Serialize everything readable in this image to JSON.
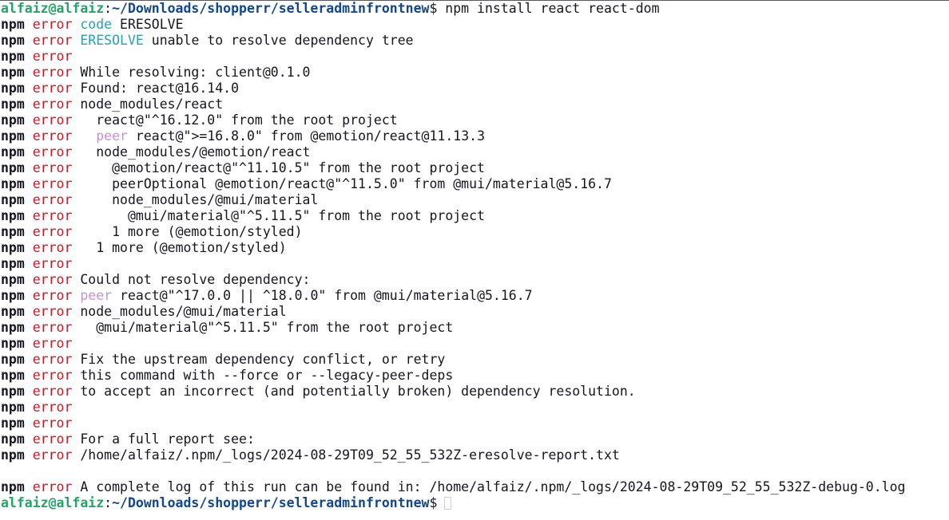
{
  "prompt": {
    "user_host": "alfaiz@alfaiz",
    "colon": ":",
    "path": "~/Downloads/shopperr/selleradminfrontnew",
    "dollar": "$"
  },
  "command": " npm install react react-dom",
  "npm_label": "npm",
  "error_label": "error",
  "lines": [
    {
      "kind": "kw",
      "keyword": "code",
      "rest": " ERESOLVE"
    },
    {
      "kind": "kw",
      "keyword": "ERESOLVE",
      "rest": " unable to resolve dependency tree"
    },
    {
      "kind": "plain",
      "text": ""
    },
    {
      "kind": "plain",
      "text": "While resolving: client@0.1.0"
    },
    {
      "kind": "plain",
      "text": "Found: react@16.14.0"
    },
    {
      "kind": "plain",
      "text": "node_modules/react"
    },
    {
      "kind": "plain",
      "text": "  react@\"^16.12.0\" from the root project"
    },
    {
      "kind": "peer",
      "indent": "  ",
      "keyword": "peer",
      "rest": " react@\">=16.8.0\" from @emotion/react@11.13.3"
    },
    {
      "kind": "plain",
      "text": "  node_modules/@emotion/react"
    },
    {
      "kind": "plain",
      "text": "    @emotion/react@\"^11.10.5\" from the root project"
    },
    {
      "kind": "plain",
      "text": "    peerOptional @emotion/react@\"^11.5.0\" from @mui/material@5.16.7"
    },
    {
      "kind": "plain",
      "text": "    node_modules/@mui/material"
    },
    {
      "kind": "plain",
      "text": "      @mui/material@\"^5.11.5\" from the root project"
    },
    {
      "kind": "plain",
      "text": "    1 more (@emotion/styled)"
    },
    {
      "kind": "plain",
      "text": "  1 more (@emotion/styled)"
    },
    {
      "kind": "plain",
      "text": ""
    },
    {
      "kind": "plain",
      "text": "Could not resolve dependency:"
    },
    {
      "kind": "peer",
      "indent": "",
      "keyword": "peer",
      "rest": " react@\"^17.0.0 || ^18.0.0\" from @mui/material@5.16.7"
    },
    {
      "kind": "plain",
      "text": "node_modules/@mui/material"
    },
    {
      "kind": "plain",
      "text": "  @mui/material@\"^5.11.5\" from the root project"
    },
    {
      "kind": "plain",
      "text": ""
    },
    {
      "kind": "plain",
      "text": "Fix the upstream dependency conflict, or retry"
    },
    {
      "kind": "plain",
      "text": "this command with --force or --legacy-peer-deps"
    },
    {
      "kind": "plain",
      "text": "to accept an incorrect (and potentially broken) dependency resolution."
    },
    {
      "kind": "plain",
      "text": ""
    },
    {
      "kind": "plain",
      "text": ""
    },
    {
      "kind": "plain",
      "text": "For a full report see:"
    },
    {
      "kind": "plain",
      "text": "/home/alfaiz/.npm/_logs/2024-08-29T09_52_55_532Z-eresolve-report.txt"
    },
    {
      "kind": "blank"
    },
    {
      "kind": "plain",
      "text": "A complete log of this run can be found in: /home/alfaiz/.npm/_logs/2024-08-29T09_52_55_532Z-debug-0.log"
    }
  ],
  "colors": {
    "background": "#ffffff",
    "foreground": "#171421",
    "prompt_user": "#26a269",
    "prompt_path": "#12488b",
    "error": "#c01c28",
    "code_keyword": "#2aa1b3",
    "peer_keyword": "#a347ba"
  }
}
